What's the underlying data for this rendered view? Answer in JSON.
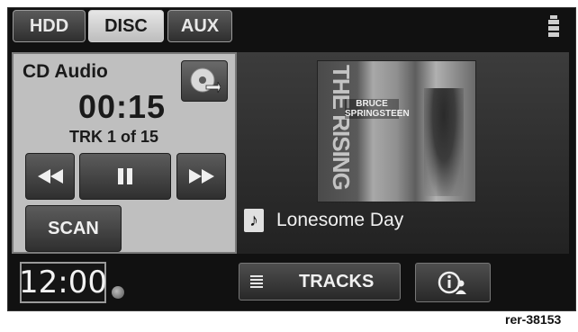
{
  "tabs": [
    {
      "label": "HDD",
      "active": false
    },
    {
      "label": "DISC",
      "active": true
    },
    {
      "label": "AUX",
      "active": false
    }
  ],
  "player": {
    "source": "CD Audio",
    "elapsed": "00:15",
    "track": "TRK 1 of 15",
    "scan_label": "SCAN"
  },
  "now_playing": {
    "album_art_title": "THE RISING",
    "album_art_artist": "BRUCE SPRINGSTEEN",
    "song": "Lonesome Day"
  },
  "bottom_bar": {
    "clock": "12:00",
    "tracks_label": "TRACKS"
  },
  "reference_code": "rer-38153",
  "colors": {
    "screen_bg": "#111111",
    "panel_bg": "#bfbfbf",
    "active_tab": "#d6d6d6",
    "button": "#3f3f3f"
  },
  "icons": [
    "settings-icon",
    "eject-icon",
    "rewind-icon",
    "pause-icon",
    "fast-forward-icon",
    "music-note-icon",
    "satellite-icon",
    "list-icon",
    "info-icon"
  ]
}
